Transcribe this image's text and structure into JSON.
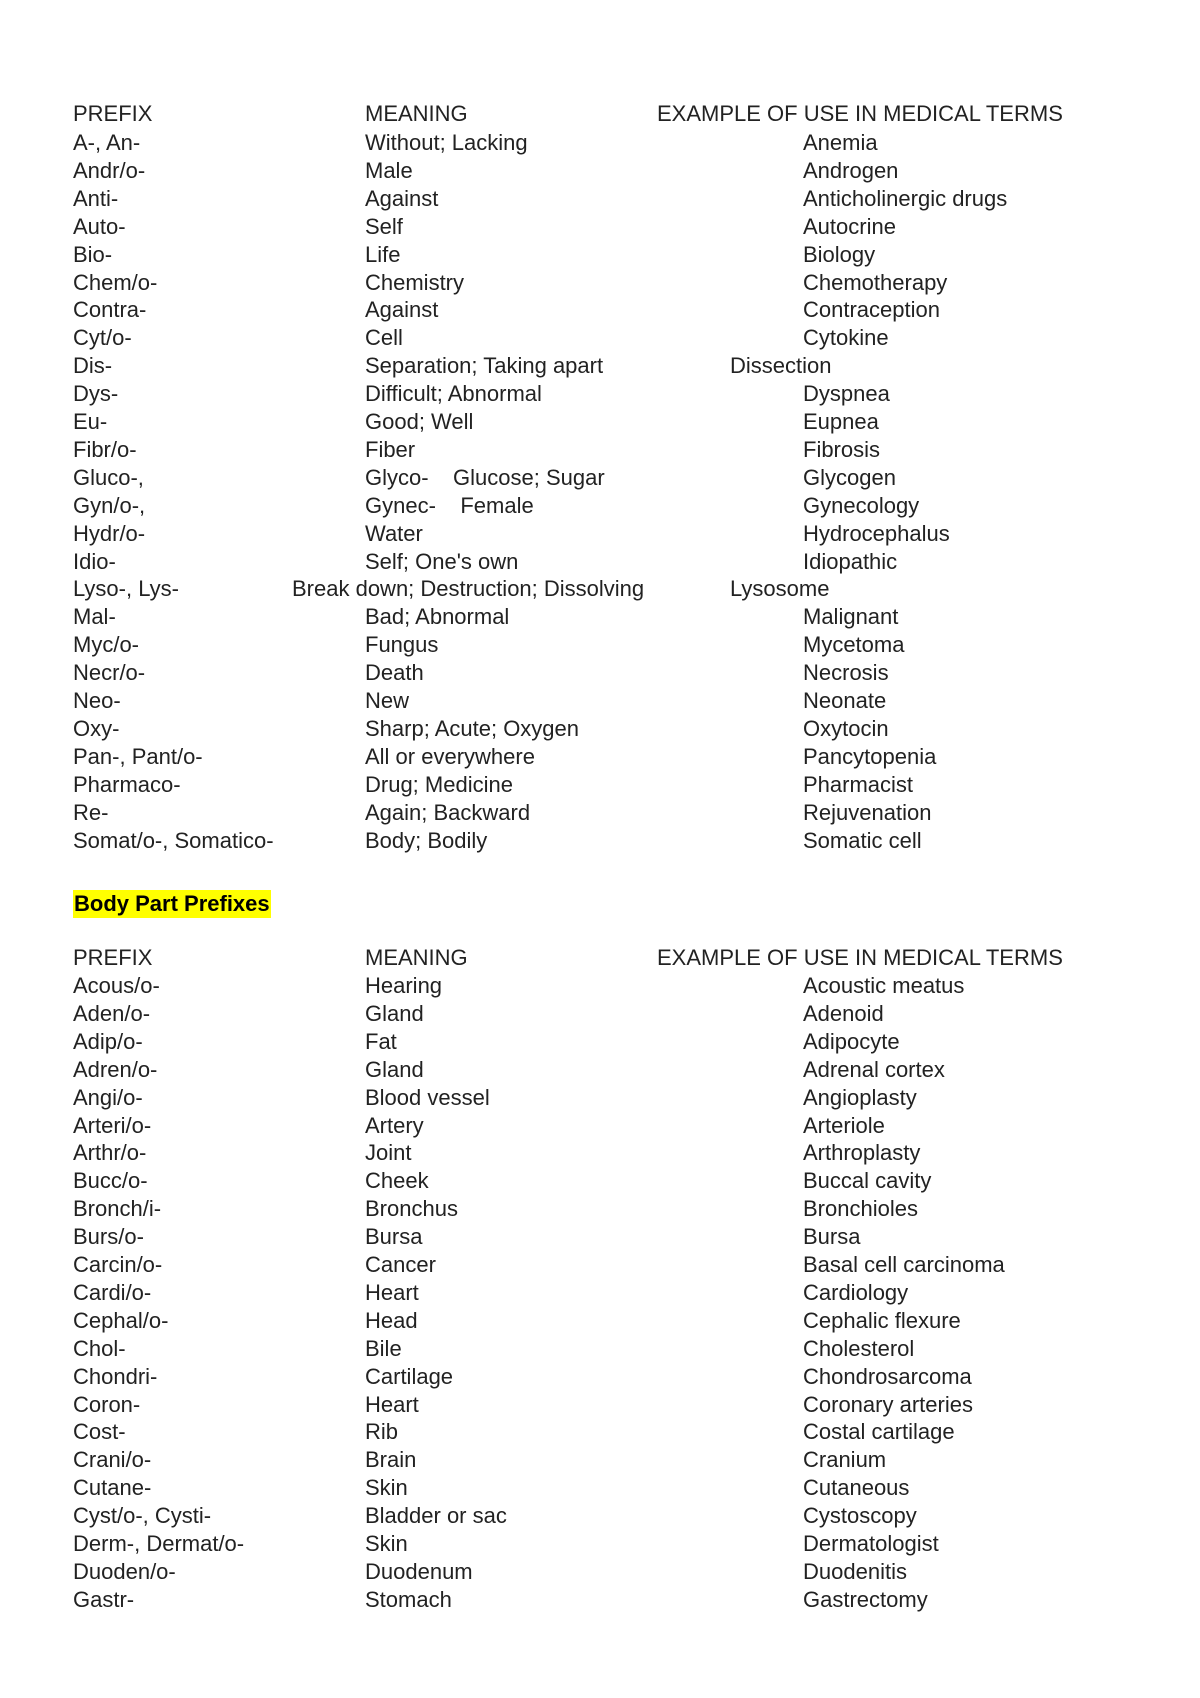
{
  "section1": {
    "headers": {
      "prefix": "PREFIX",
      "meaning": "MEANING",
      "example": "EXAMPLE OF USE IN MEDICAL TERMS"
    },
    "rows": [
      {
        "prefix": "A-, An-",
        "meaning": "Without; Lacking",
        "example": "Anemia"
      },
      {
        "prefix": "Andr/o-",
        "meaning": "Male",
        "example": "Androgen"
      },
      {
        "prefix": "Anti-",
        "meaning": "Against",
        "example": "Anticholinergic drugs"
      },
      {
        "prefix": "Auto-",
        "meaning": "Self",
        "example": "Autocrine"
      },
      {
        "prefix": "Bio-",
        "meaning": "Life",
        "example": "Biology"
      },
      {
        "prefix": "Chem/o-",
        "meaning": "Chemistry",
        "example": "Chemotherapy"
      },
      {
        "prefix": "Contra-",
        "meaning": "Against",
        "example": "Contraception"
      },
      {
        "prefix": "Cyt/o-",
        "meaning": "Cell",
        "example": "Cytokine"
      },
      {
        "prefix": "Dis-",
        "meaning": "Separation; Taking apart",
        "example": "Dissection"
      },
      {
        "prefix": "Dys-",
        "meaning": "Difficult; Abnormal",
        "example": "Dyspnea"
      },
      {
        "prefix": "Eu-",
        "meaning": "Good; Well",
        "example": "Eupnea"
      },
      {
        "prefix": "Fibr/o-",
        "meaning": "Fiber",
        "example": "Fibrosis"
      },
      {
        "prefix": "Gluco-,",
        "meaning": "Glyco-    Glucose; Sugar",
        "example": "Glycogen"
      },
      {
        "prefix": "Gyn/o-,",
        "meaning": "Gynec-    Female",
        "example": "Gynecology"
      },
      {
        "prefix": "Hydr/o-",
        "meaning": "Water",
        "example": "Hydrocephalus"
      },
      {
        "prefix": "Idio-",
        "meaning": "Self; One's own",
        "example": "Idiopathic"
      },
      {
        "prefix": "Lyso-, Lys-",
        "meaning": "Break down; Destruction; Dissolving",
        "example": "Lysosome"
      },
      {
        "prefix": "Mal-",
        "meaning": "Bad; Abnormal",
        "example": "Malignant"
      },
      {
        "prefix": "Myc/o-",
        "meaning": "Fungus",
        "example": "Mycetoma"
      },
      {
        "prefix": "Necr/o-",
        "meaning": "Death",
        "example": "Necrosis"
      },
      {
        "prefix": "Neo-",
        "meaning": "New",
        "example": "Neonate"
      },
      {
        "prefix": "Oxy-",
        "meaning": "Sharp; Acute; Oxygen",
        "example": "Oxytocin"
      },
      {
        "prefix": "Pan-, Pant/o-",
        "meaning": "All or everywhere",
        "example": "Pancytopenia"
      },
      {
        "prefix": "Pharmaco-",
        "meaning": "Drug; Medicine",
        "example": "Pharmacist"
      },
      {
        "prefix": "Re-",
        "meaning": "Again; Backward",
        "example": "Rejuvenation"
      },
      {
        "prefix": "Somat/o-, Somatico-",
        "meaning": "Body; Bodily",
        "example": "Somatic cell"
      }
    ]
  },
  "section2": {
    "title": "Body Part Prefixes",
    "highlight_color": "#ffff00",
    "headers": {
      "prefix": "PREFIX",
      "meaning": "MEANING",
      "example": "EXAMPLE OF USE IN MEDICAL TERMS"
    },
    "rows": [
      {
        "prefix": "Acous/o-",
        "meaning": "Hearing",
        "example": "Acoustic meatus"
      },
      {
        "prefix": "Aden/o-",
        "meaning": "Gland",
        "example": "Adenoid"
      },
      {
        "prefix": "Adip/o-",
        "meaning": "Fat",
        "example": "Adipocyte"
      },
      {
        "prefix": "Adren/o-",
        "meaning": "Gland",
        "example": "Adrenal cortex"
      },
      {
        "prefix": "Angi/o-",
        "meaning": "Blood vessel",
        "example": "Angioplasty"
      },
      {
        "prefix": "Arteri/o-",
        "meaning": "Artery",
        "example": "Arteriole"
      },
      {
        "prefix": "Arthr/o-",
        "meaning": "Joint",
        "example": "Arthroplasty"
      },
      {
        "prefix": "Bucc/o-",
        "meaning": "Cheek",
        "example": "Buccal cavity"
      },
      {
        "prefix": "Bronch/i-",
        "meaning": "Bronchus",
        "example": "Bronchioles"
      },
      {
        "prefix": "Burs/o-",
        "meaning": "Bursa",
        "example": "Bursa"
      },
      {
        "prefix": "Carcin/o-",
        "meaning": "Cancer",
        "example": "Basal cell carcinoma"
      },
      {
        "prefix": "Cardi/o-",
        "meaning": "Heart",
        "example": "Cardiology"
      },
      {
        "prefix": "Cephal/o-",
        "meaning": "Head",
        "example": "Cephalic flexure"
      },
      {
        "prefix": "Chol-",
        "meaning": "Bile",
        "example": "Cholesterol"
      },
      {
        "prefix": "Chondri-",
        "meaning": "Cartilage",
        "example": "Chondrosarcoma"
      },
      {
        "prefix": "Coron-",
        "meaning": "Heart",
        "example": "Coronary arteries"
      },
      {
        "prefix": "Cost-",
        "meaning": "Rib",
        "example": "Costal cartilage"
      },
      {
        "prefix": "Crani/o-",
        "meaning": "Brain",
        "example": "Cranium"
      },
      {
        "prefix": "Cutane-",
        "meaning": "Skin",
        "example": "Cutaneous"
      },
      {
        "prefix": "Cyst/o-, Cysti-",
        "meaning": "Bladder or sac",
        "example": "Cystoscopy"
      },
      {
        "prefix": "Derm-, Dermat/o-",
        "meaning": "Skin",
        "example": "Dermatologist"
      },
      {
        "prefix": "Duoden/o-",
        "meaning": "Duodenum",
        "example": "Duodenitis"
      },
      {
        "prefix": "Gastr-",
        "meaning": "Stomach",
        "example": "Gastrectomy"
      }
    ]
  }
}
